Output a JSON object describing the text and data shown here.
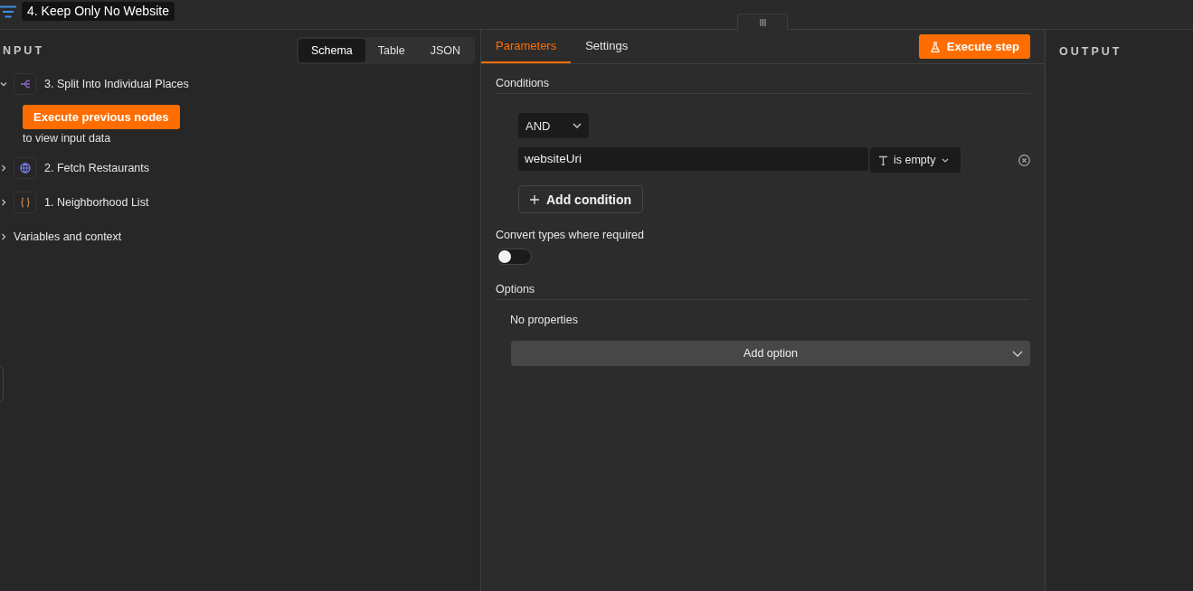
{
  "header": {
    "title": "4. Keep Only No Website"
  },
  "input_panel": {
    "heading": "NPUT",
    "view_tabs": [
      {
        "label": "Schema",
        "selected": true
      },
      {
        "label": "Table",
        "selected": false
      },
      {
        "label": "JSON",
        "selected": false
      }
    ],
    "nodes": [
      {
        "label": "3. Split Into Individual Places",
        "kind": "split",
        "expanded": true,
        "button": "Execute previous nodes",
        "hint": "to view input data"
      },
      {
        "label": "2. Fetch Restaurants",
        "kind": "http",
        "expanded": false
      },
      {
        "label": "1. Neighborhood List",
        "kind": "code",
        "expanded": false
      },
      {
        "label": "Variables and context",
        "kind": "context",
        "expanded": false
      }
    ]
  },
  "parameters_panel": {
    "tabs": [
      {
        "label": "Parameters",
        "selected": true
      },
      {
        "label": "Settings",
        "selected": false
      }
    ],
    "execute_button": "Execute step",
    "conditions": {
      "heading": "Conditions",
      "combinator": "AND",
      "rows": [
        {
          "field": "websiteUri",
          "operator": "is empty"
        }
      ],
      "add_button": "Add condition"
    },
    "convert_types": {
      "label": "Convert types where required",
      "on": false
    },
    "options": {
      "heading": "Options",
      "empty_text": "No properties",
      "add_button": "Add option"
    }
  },
  "output_panel": {
    "heading": "OUTPUT"
  }
}
